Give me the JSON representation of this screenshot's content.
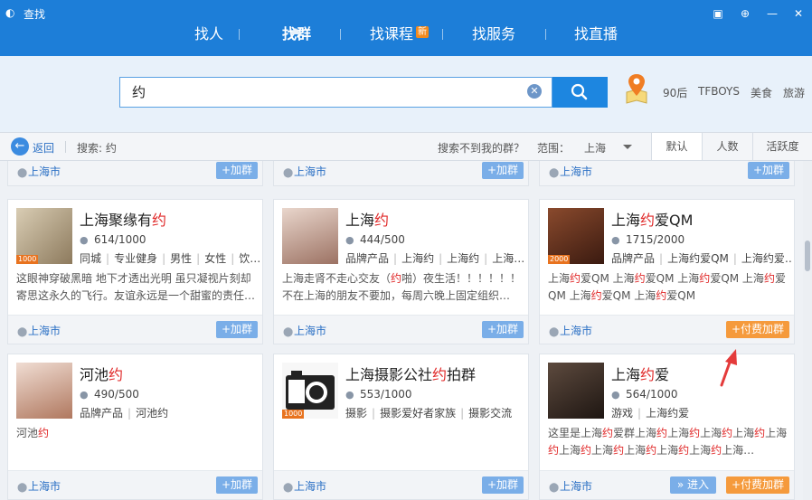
{
  "window": {
    "title": "查找"
  },
  "nav": {
    "tabs": [
      {
        "label": "找人"
      },
      {
        "label": "找群"
      },
      {
        "label": "找课程"
      },
      {
        "label": "找服务"
      },
      {
        "label": "找直播"
      }
    ],
    "new_badge": "新"
  },
  "search": {
    "value": "约",
    "hot_tags": [
      "90后",
      "TFBOYS",
      "美食",
      "旅游"
    ]
  },
  "toolbar": {
    "back_label": "返回",
    "keyword_label": "搜索: 约",
    "not_found": "搜索不到我的群？",
    "range_label": "范围：",
    "range_value": "上海",
    "sort_tabs": [
      "默认",
      "人数",
      "活跃度"
    ]
  },
  "top_row": {
    "locations": [
      "上海市",
      "上海市",
      "上海市"
    ],
    "join_label": "+加群"
  },
  "groups": [
    {
      "name_pre": "上海聚缘有",
      "name_hl": "约",
      "name_post": "",
      "level": "1000",
      "members": "614/1000",
      "tags": [
        "同城",
        "专业健身",
        "男性",
        "女性",
        "饮…"
      ],
      "desc": "这眼神穿破黑暗 地下才透出光明 虽只凝视片刻却寄思这永久的飞行。友谊永远是一个甜蜜的责任…",
      "location": "上海市",
      "buttons": {
        "join": "+加群"
      }
    },
    {
      "name_pre": "上海",
      "name_hl": "约",
      "name_post": "",
      "level": "",
      "members": "444/500",
      "tags": [
        "品牌产品",
        "上海约",
        "上海约",
        "上海…"
      ],
      "desc_parts": [
        "上海走肾不走心交友（",
        "约",
        "啪）夜生活！！！！！！不在上海的朋友不要加，每周六晚上固定组织…"
      ],
      "location": "上海市",
      "buttons": {
        "join": "+加群"
      }
    },
    {
      "name_pre": "上海",
      "name_hl": "约",
      "name_post": "爱QM",
      "level": "2000",
      "members": "1715/2000",
      "tags": [
        "品牌产品",
        "上海约爱QM",
        "上海约爱…"
      ],
      "desc_parts": [
        "上海",
        "约",
        "爱QM 上海",
        "约",
        "爱QM 上海",
        "约",
        "爱QM 上海",
        "约",
        "爱QM 上海",
        "约",
        "爱QM 上海",
        "约",
        "爱QM"
      ],
      "location": "上海市",
      "buttons": {
        "pay": "+付费加群"
      }
    },
    {
      "name_pre": "河池",
      "name_hl": "约",
      "name_post": "",
      "level": "",
      "members": "490/500",
      "tags": [
        "品牌产品",
        "河池约"
      ],
      "desc_parts": [
        "河池",
        "约"
      ],
      "location": "上海市",
      "buttons": {
        "join": "+加群"
      }
    },
    {
      "name_pre": "上海摄影公社",
      "name_hl": "约",
      "name_post": "拍群",
      "level": "1000",
      "members": "553/1000",
      "tags": [
        "摄影",
        "摄影爱好者家族",
        "摄影交流"
      ],
      "location": "上海市",
      "buttons": {
        "join": "+加群"
      }
    },
    {
      "name_pre": "上海",
      "name_hl": "约",
      "name_post": "爱",
      "level": "",
      "members": "564/1000",
      "tags": [
        "游戏",
        "上海约爱"
      ],
      "desc_parts": [
        "这里是上海",
        "约",
        "爱群上海",
        "约",
        "上海",
        "约",
        "上海",
        "约",
        "上海",
        "约",
        "上海",
        "约",
        "上海",
        "约",
        "上海",
        "约",
        "上海",
        "约",
        "上海",
        "约",
        "上海",
        "约",
        "上海…"
      ],
      "location": "上海市",
      "buttons": {
        "enter": "» 进入",
        "pay": "+付费加群"
      }
    }
  ],
  "colors": {
    "header": "#1d7ed8",
    "highlight": "#e02828",
    "pay": "#f59a3c",
    "join": "#7aaee8"
  }
}
